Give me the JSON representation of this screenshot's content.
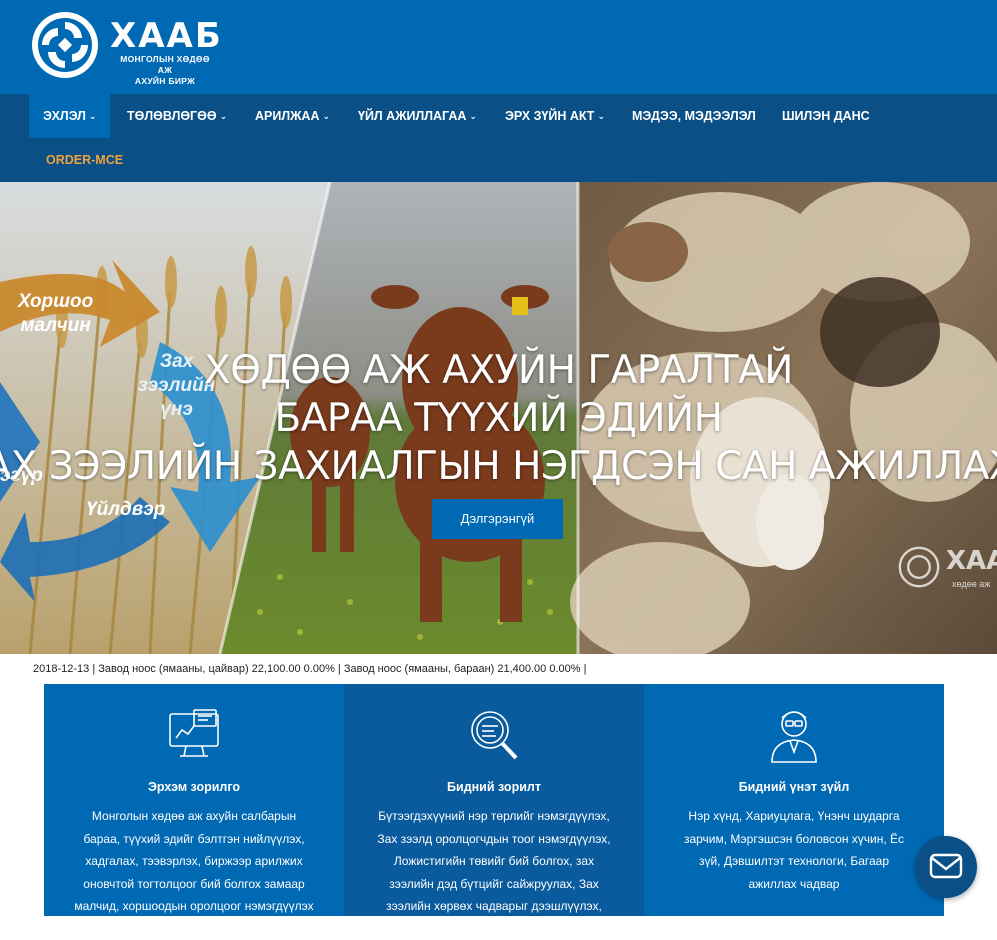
{
  "header": {
    "logo_word": "ХААБ",
    "logo_sub_line1": "МОНГОЛЫН ХӨДӨӨ АЖ",
    "logo_sub_line2": "АХУЙН БИРЖ",
    "bg_color": "#0069b4"
  },
  "nav": {
    "items": [
      {
        "label": "ЭХЛЭЛ",
        "has_dropdown": true,
        "active": true
      },
      {
        "label": "ТӨЛӨВЛӨГӨӨ",
        "has_dropdown": true
      },
      {
        "label": "АРИЛЖАА",
        "has_dropdown": true
      },
      {
        "label": "ҮЙЛ АЖИЛЛАГАА",
        "has_dropdown": true
      },
      {
        "label": "ЭРХ ЗҮЙН АКТ",
        "has_dropdown": true
      },
      {
        "label": "МЭДЭЭ, МЭДЭЭЛЭЛ",
        "has_dropdown": false
      },
      {
        "label": "ШИЛЭН ДАНС",
        "has_dropdown": false
      },
      {
        "label": "ORDER-MCE",
        "has_dropdown": false
      }
    ],
    "chevron": "⌄",
    "order_color": "#f0a13a"
  },
  "hero": {
    "title_line1": "ХӨДӨӨ АЖ АХУЙН ГАРАЛТАЙ",
    "title_line2": "БАРАА ТҮҮХИЙ ЭДИЙН",
    "title_line3": "ЗАХ ЗЭЭЛИЙН ЗАХИАЛГЫН НЭГДСЭН САН АЖИЛЛАЖ ЭХЭЛЛЭЭ",
    "button_label": "Дэлгэрэнгүй",
    "cycle_labels": {
      "a_line1": "Хоршоо",
      "a_line2": "малчин",
      "b_line1": "Зах",
      "b_line2": "зээлийн",
      "b_line3": "үнэ",
      "c": "Үйлдвэр",
      "d": "эгүр"
    },
    "watermark_word": "ХААБ",
    "watermark_sub": "хөдөө аж"
  },
  "ticker": {
    "text": "2018-12-13 | Завод ноос (ямааны, цайвар) 22,100.00 0.00% | Завод ноос (ямааны, бараан) 21,400.00 0.00% |"
  },
  "features": [
    {
      "icon": "computer-icon",
      "title": "Эрхэм зорилго",
      "text": "Монголын хөдөө аж ахуйн салбарын бараа, түүхий эдийг бэлтгэн нийлүүлэх, хадгалах, тээвэрлэх, биржээр арилжих оновчтой тогтолцоог бий болгох замаар малчид, хоршоодын оролцоог нэмэгдүүлэх"
    },
    {
      "icon": "magnifier-icon",
      "title": "Бидний зорилт",
      "text": "Бүтээгдэхүүний нэр төрлийг нэмэгдүүлэх, Зах зээлд оролцогчдын тоог нэмэгдүүлэх, Ложистигийн төвийг бий болгох, зах зээлийн дэд бүтцийг сайжруулах, Зах зээлийн хөрвөх чадварыг дээшлүүлэх, Касс"
    },
    {
      "icon": "person-icon",
      "title": "Бидний үнэт зүйл",
      "text": "Нэр хүнд, Хариуцлага, Үнэнч шударга зарчим, Мэргэшсэн боловсон хүчин, Ёс зүй, Дэвшилтэт технологи, Багаар ажиллах чадвар"
    }
  ],
  "chat": {
    "icon": "envelope-icon"
  }
}
